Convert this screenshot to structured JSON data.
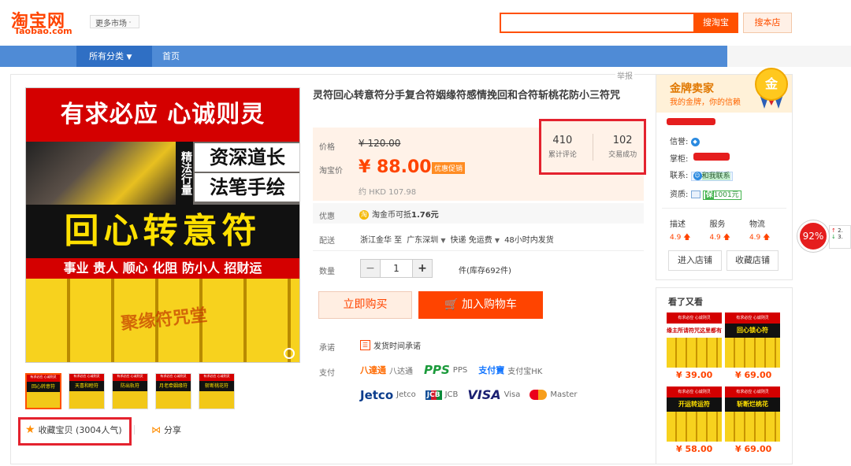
{
  "header": {
    "logo_cn": "淘宝网",
    "logo_en": "Taobao.com",
    "more_market": "更多市场",
    "search_placeholder": "",
    "search_button": "搜淘宝",
    "store_button": "搜本店"
  },
  "nav": {
    "all_categories": "所有分类",
    "home": "首页"
  },
  "report": "举报",
  "gallery": {
    "main_top": "有求必应 心诚则灵",
    "main_vertical": "精法行量",
    "main_banner1": "资深道长",
    "main_banner2": "法笔手绘",
    "main_big": "回心转意符",
    "main_tags": "事业 贵人 顺心 化阻 防小人 招财运",
    "main_watermark": "聚缘符咒堂",
    "thumbs": [
      {
        "top": "有求必应 心诚则灵",
        "mid": "回心转意符"
      },
      {
        "top": "有求必应 心诚则灵",
        "mid": "天喜和睦符"
      },
      {
        "top": "有求必应 心诚则灵",
        "mid": "防出轨符"
      },
      {
        "top": "有求必应 心诚则灵",
        "mid": "月老牵姻缘符"
      },
      {
        "top": "有求必应 心诚则灵",
        "mid": "斩断桃花符"
      }
    ],
    "favorite": "收藏宝贝 (3004人气)",
    "share": "分享"
  },
  "product": {
    "title": "灵符回心转意符分手复合符姻缘符感情挽回和合符斩桃花防小三符咒",
    "price_label": "价格",
    "old_price": "¥ 120.00",
    "taobao_price_label": "淘宝价",
    "new_price": "¥ 88.00",
    "promo_tag": "优惠促销",
    "hkd": "约 HKD 107.98",
    "stats": [
      {
        "value": "410",
        "label": "累计评论"
      },
      {
        "value": "102",
        "label": "交易成功"
      }
    ],
    "discount_label": "优惠",
    "discount_text": "淘金币可抵",
    "discount_amount": "1.76元",
    "ship_label": "配送",
    "ship_from": "浙江金华 至",
    "ship_to": "广东深圳",
    "ship_express": "快递 免运费",
    "ship_time": "48小时内发货",
    "qty_label": "数量",
    "qty_value": "1",
    "qty_stock": "件(库存692件)",
    "buy_now": "立即购买",
    "add_cart": "加入购物车",
    "promise_label": "承诺",
    "promise_text": "发货时间承诺",
    "pay_label": "支付",
    "pay_methods_row1": [
      "八达通",
      "PPS",
      "支付宝HK"
    ],
    "pay_methods_row2": [
      "Jetco",
      "JCB",
      "Visa",
      "Master"
    ]
  },
  "seller": {
    "gold_title": "金牌卖家",
    "gold_sub": "我的金牌，你的信赖",
    "medal": "金",
    "credit_label": "信誉:",
    "owner_label": "掌柜:",
    "contact_label": "联系:",
    "contact_text": "和我联系",
    "qual_label": "资质:",
    "qual_value": "1001元",
    "dyn": [
      {
        "name": "描述",
        "score": "4.9"
      },
      {
        "name": "服务",
        "score": "4.9"
      },
      {
        "name": "物流",
        "score": "4.9"
      }
    ],
    "enter_store": "进入店铺",
    "fav_store": "收藏店铺"
  },
  "also_viewed": {
    "title": "看了又看",
    "items": [
      {
        "mid": "缘主所请符咒这里都有",
        "price": "¥ 39.00"
      },
      {
        "mid": "回心锁心符",
        "price": "¥ 69.00"
      },
      {
        "mid": "开运转运符",
        "price": "¥ 58.00"
      },
      {
        "mid": "斩断烂桃花",
        "price": "¥ 69.00"
      }
    ],
    "rec_top": "有求必应 心诚则灵"
  },
  "side": {
    "percent": "92%",
    "up": "2.",
    "down": "3."
  },
  "colors": {
    "brand": "#ff4400",
    "nav_blue": "#4f8bd6",
    "highlight_red": "#e4222e"
  }
}
